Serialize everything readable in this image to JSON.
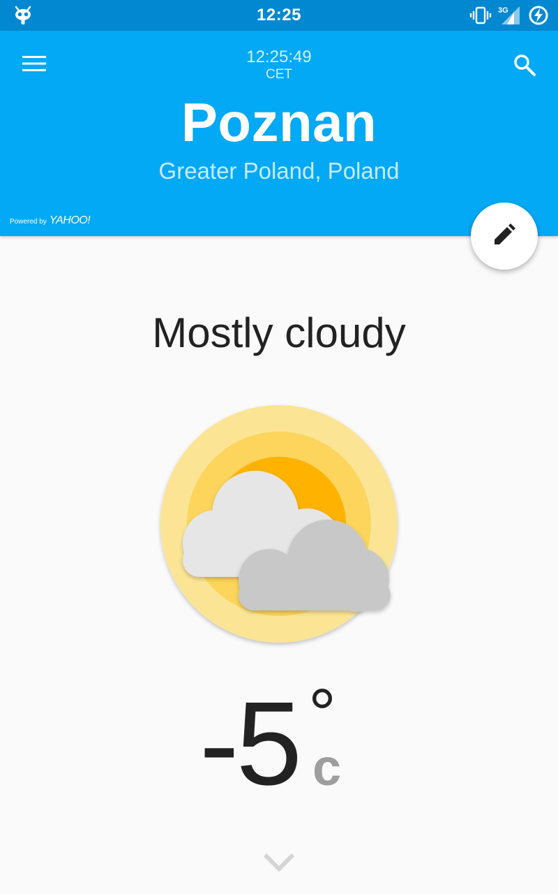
{
  "status_bar": {
    "time": "12:25",
    "network_label": "3G",
    "icons": [
      "cyanogen-robot-icon",
      "vibrate-icon",
      "cell-signal-icon",
      "battery-charging-icon"
    ]
  },
  "header": {
    "local_time": "12:25:49",
    "timezone": "CET",
    "city": "Poznan",
    "region": "Greater Poland, Poland",
    "powered_by": "Powered by",
    "provider": "YAHOO!",
    "icons": [
      "menu-icon",
      "search-icon"
    ]
  },
  "fab": {
    "icon": "pencil-icon"
  },
  "weather": {
    "condition": "Mostly cloudy",
    "temperature": "-5",
    "degree_symbol": "°",
    "unit": "c",
    "illustration": "sun-behind-clouds-icon"
  },
  "footer": {
    "icon": "chevron-down-icon"
  },
  "colors": {
    "status_bar": "#0288d1",
    "header": "#03a9f4",
    "background": "#fafafa",
    "sun_outer": "#fbe595",
    "sun_middle": "#fdd55c",
    "sun_inner": "#ffb300",
    "cloud_light": "#e6e6e6",
    "cloud_dark": "#c8c8c8"
  }
}
